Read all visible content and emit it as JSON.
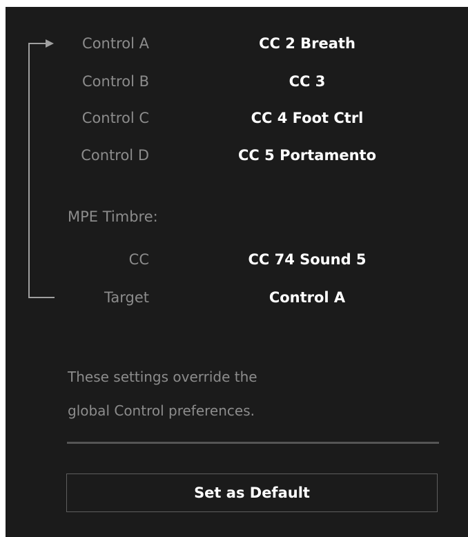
{
  "controls": [
    {
      "label": "Control A",
      "value": "CC 2 Breath"
    },
    {
      "label": "Control B",
      "value": "CC 3"
    },
    {
      "label": "Control C",
      "value": "CC 4 Foot Ctrl"
    },
    {
      "label": "Control D",
      "value": "CC 5 Portamento"
    }
  ],
  "mpe": {
    "heading": "MPE Timbre:",
    "cc_label": "CC",
    "cc_value": "CC 74 Sound 5",
    "target_label": "Target",
    "target_value": "Control A"
  },
  "note": {
    "line1": "These settings override the",
    "line2": "global Control preferences."
  },
  "buttons": {
    "set_default": "Set as Default"
  },
  "colors": {
    "background": "#1b1b1b",
    "label": "#8c8c8c",
    "value": "#ffffff",
    "bracket": "#a0a0a0"
  },
  "icons": {
    "routing_bracket": "arrow-right-bracket-icon"
  }
}
